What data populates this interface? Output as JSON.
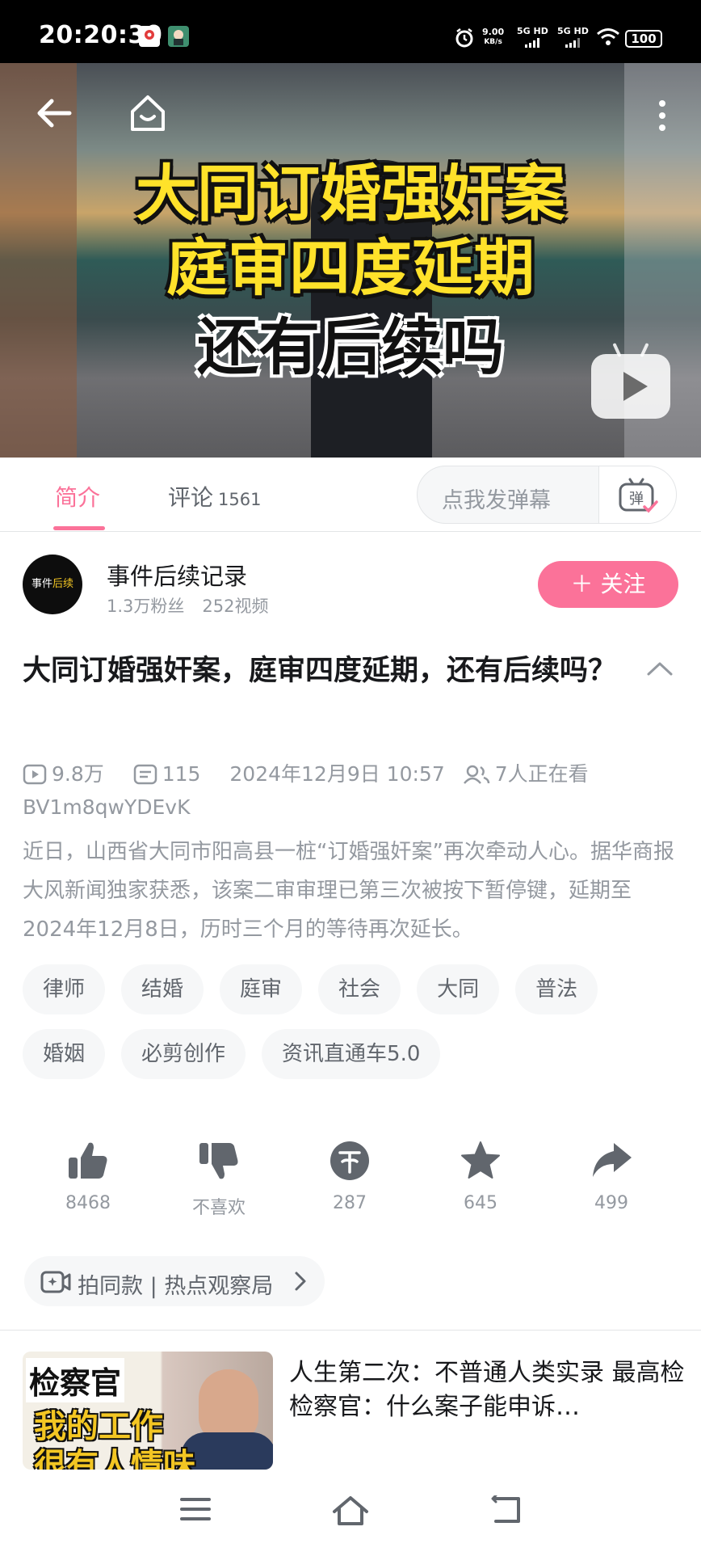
{
  "status_bar": {
    "time": "20:20:30",
    "net_speed_value": "9.00",
    "net_speed_unit": "KB/s",
    "signal1": "5G HD",
    "signal2": "5G HD",
    "battery": "100"
  },
  "video": {
    "overlay_line1": "大同订婚强奸案",
    "overlay_line2": "庭审四度延期",
    "overlay_line3": "还有后续吗",
    "icons": [
      "back-arrow-icon",
      "home-icon",
      "more-vertical-icon",
      "tv-play-icon"
    ]
  },
  "tabs": {
    "intro_label": "简介",
    "comments_label": "评论",
    "comments_count": "1561",
    "danmaku_placeholder": "点我发弹幕",
    "danmaku_button_label": "弹"
  },
  "uploader": {
    "avatar_text_a": "事件",
    "avatar_text_b": "后续",
    "name": "事件后续记录",
    "followers": "1.3万粉丝",
    "videos": "252视频",
    "follow_label": "＋ 关注"
  },
  "video_info": {
    "title": "大同订婚强奸案，庭审四度延期，还有后续吗？",
    "play_count": "9.8万",
    "danmaku_count": "115",
    "publish_time": "2024年12月9日 10:57",
    "watching": "7人正在看",
    "bvid": "BV1m8qwYDEvK",
    "description": "近日，山西省大同市阳高县一桩“订婚强奸案”再次牵动人心。据华商报大风新闻独家获悉，该案二审审理已第三次被按下暂停键，延期至2024年12月8日，历时三个月的等待再次延长。"
  },
  "tags": [
    "律师",
    "结婚",
    "庭审",
    "社会",
    "大同",
    "普法",
    "婚姻",
    "必剪创作",
    "资讯直通车5.0"
  ],
  "actions": {
    "like": "8468",
    "dislike": "不喜欢",
    "coin": "287",
    "favorite": "645",
    "share": "499"
  },
  "same_style": {
    "label": "拍同款 | 热点观察局"
  },
  "recommended": {
    "thumb_line1": "检察官",
    "thumb_line2": "我的工作",
    "thumb_line3": "很有人情味",
    "title": "人生第二次：不普通人类实录 最高检检察官：什么案子能申诉…"
  },
  "colors": {
    "accent": "#fb7299",
    "text_primary": "#18191c",
    "text_secondary": "#9499a0",
    "tag_bg": "#f6f7f8"
  }
}
